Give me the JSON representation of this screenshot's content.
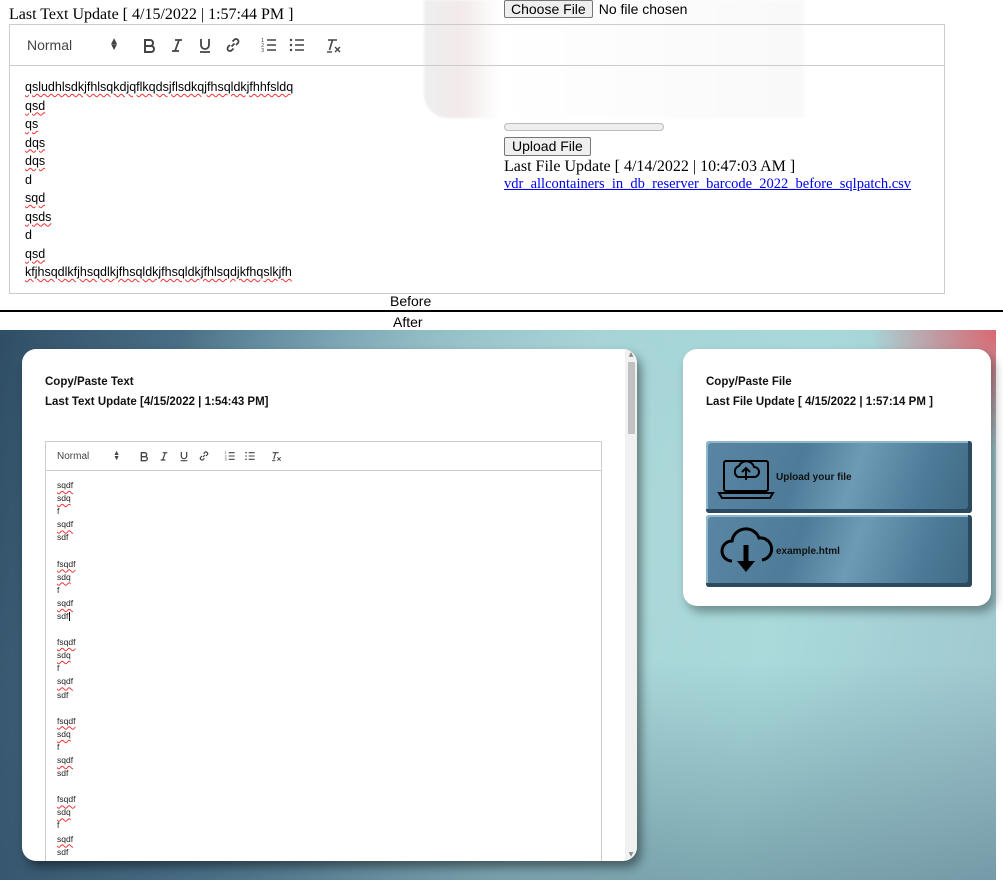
{
  "labels": {
    "before": "Before",
    "after": "After"
  },
  "before": {
    "last_text_update": "Last Text Update [ 4/15/2022 | 1:57:44 PM ]",
    "editor": {
      "format_select": "Normal",
      "lines": [
        "qsludhlsdkjfhlsqkdjqflkqdsjflsdkqjfhsqldkjfhhfsldq",
        "qsd",
        "qs",
        "dqs",
        "dqs",
        "d",
        "sqd",
        "qsds",
        "d",
        "qsd",
        "kfjhsqdlkfjhsqdlkjfhsqldkjfhsqldkjfhlsqdjkfhqslkjfh"
      ]
    },
    "file": {
      "choose_button": "Choose File",
      "no_file": "No file chosen",
      "upload_button": "Upload File",
      "last_file_update": "Last File Update [ 4/14/2022 | 10:47:03 AM ]",
      "file_link": "vdr_allcontainers_in_db_reserver_barcode_2022_before_sqlpatch.csv"
    }
  },
  "after": {
    "text_card": {
      "title": "Copy/Paste Text",
      "last_update": "Last Text Update [4/15/2022 | 1:54:43 PM]",
      "format_select": "Normal",
      "lines": [
        "sqdf",
        "sdq",
        "f",
        "sqdf",
        "sdf",
        "",
        "fsqdf",
        "sdq",
        "f",
        "sqdf",
        "sdf",
        "",
        "fsqdf",
        "sdq",
        "f",
        "sqdf",
        "sdf",
        "",
        "fsqdf",
        "sdq",
        "f",
        "sqdf",
        "sdf",
        "",
        "fsqdf",
        "sdq",
        "f",
        "sqdf",
        "sdf"
      ]
    },
    "file_card": {
      "title": "Copy/Paste File",
      "last_update": "Last File Update [ 4/15/2022 | 1:57:14 PM ]",
      "upload_label": "Upload your file",
      "download_label": "example.html",
      "upload_icon": "laptop-cloud-upload-icon",
      "download_icon": "cloud-download-icon"
    }
  }
}
